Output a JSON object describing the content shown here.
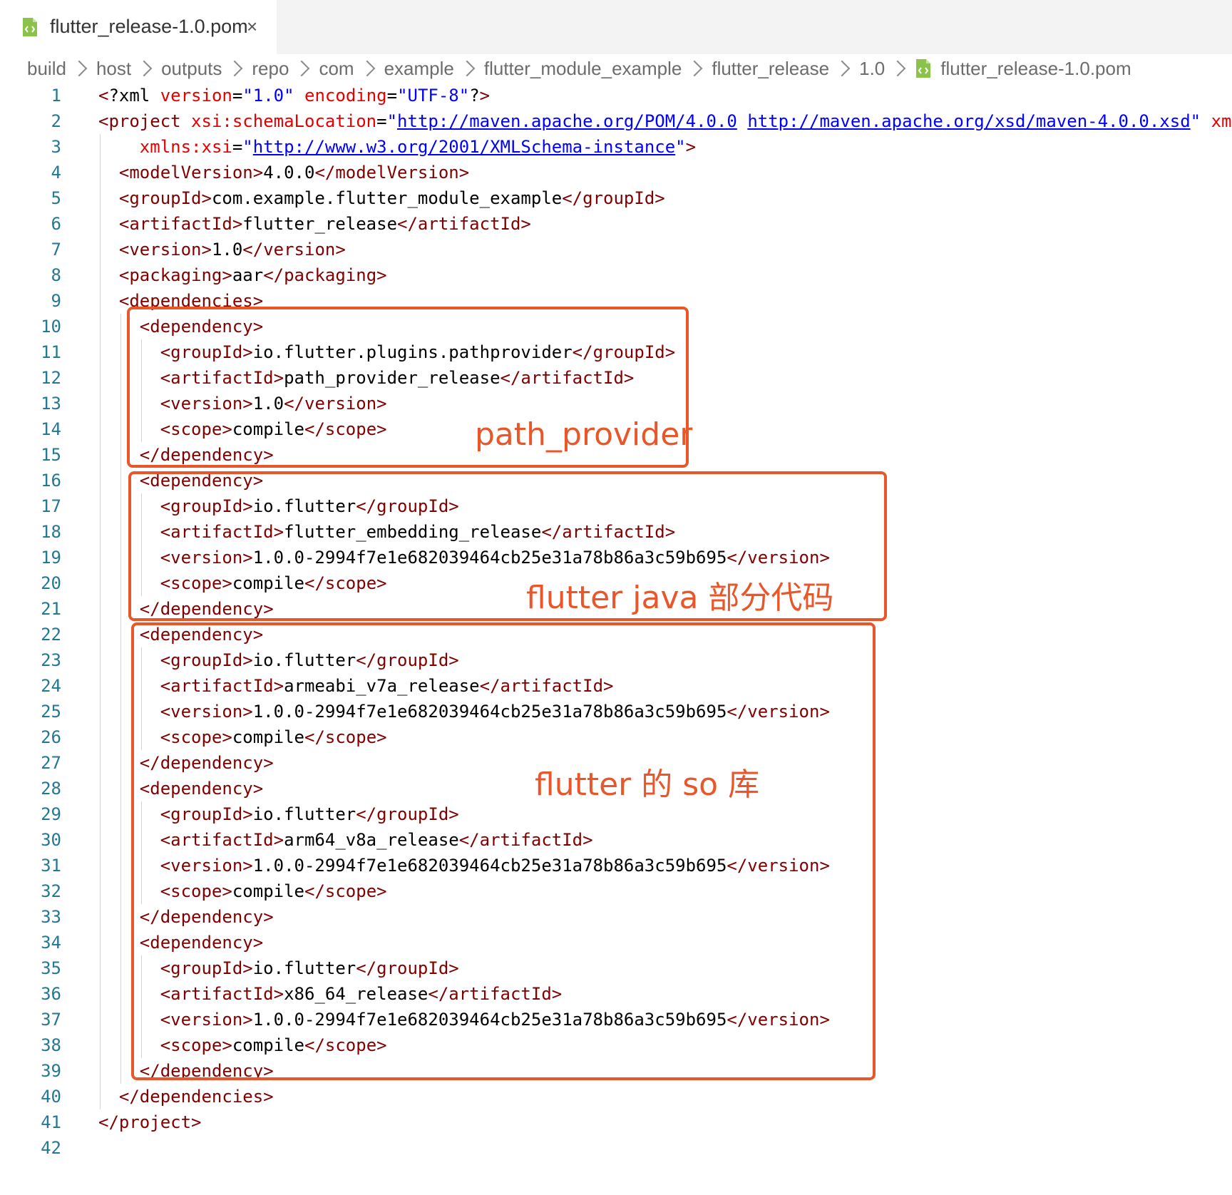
{
  "tab": {
    "title": "flutter_release-1.0.pom",
    "close_glyph": "×",
    "icon": "xml-file-icon"
  },
  "breadcrumb": [
    "build",
    "host",
    "outputs",
    "repo",
    "com",
    "example",
    "flutter_module_example",
    "flutter_release",
    "1.0",
    "flutter_release-1.0.pom"
  ],
  "colors": {
    "tag": "#800000",
    "attribute": "#e50000",
    "string": "#0000ff",
    "line_number": "#237893",
    "annotation": "#e8562a"
  },
  "code_lines": [
    [
      [
        "<",
        "t"
      ],
      [
        "?xml ",
        ""
      ],
      [
        "version",
        "a"
      ],
      [
        "=",
        ""
      ],
      [
        "\"1.0\"",
        "s"
      ],
      [
        " ",
        ""
      ],
      [
        "encoding",
        "a"
      ],
      [
        "=",
        ""
      ],
      [
        "\"UTF-8\"",
        "s"
      ],
      [
        "?",
        ""
      ],
      [
        ">",
        "t"
      ]
    ],
    [
      [
        "<project ",
        "t"
      ],
      [
        "xsi:schemaLocation",
        "a"
      ],
      [
        "=",
        ""
      ],
      [
        "\"",
        "s"
      ],
      [
        "http://maven.apache.org/POM/4.0.0",
        "u"
      ],
      [
        " ",
        ""
      ],
      [
        "http://maven.apache.org/xsd/maven-4.0.0.xsd",
        "u"
      ],
      [
        "\"",
        "s"
      ],
      [
        " ",
        ""
      ],
      [
        "xm",
        "a"
      ]
    ],
    [
      [
        "  ",
        ""
      ],
      [
        "xmlns:xsi",
        "a"
      ],
      [
        "=",
        ""
      ],
      [
        "\"",
        "s"
      ],
      [
        "http://www.w3.org/2001/XMLSchema-instance",
        "u"
      ],
      [
        "\"",
        "s"
      ],
      [
        ">",
        "t"
      ]
    ],
    [
      [
        "<modelVersion>",
        "t"
      ],
      [
        "4.0.0",
        ""
      ],
      [
        "</modelVersion>",
        "t"
      ]
    ],
    [
      [
        "<groupId>",
        "t"
      ],
      [
        "com.example.flutter_module_example",
        ""
      ],
      [
        "</groupId>",
        "t"
      ]
    ],
    [
      [
        "<artifactId>",
        "t"
      ],
      [
        "flutter_release",
        ""
      ],
      [
        "</artifactId>",
        "t"
      ]
    ],
    [
      [
        "<version>",
        "t"
      ],
      [
        "1.0",
        ""
      ],
      [
        "</version>",
        "t"
      ]
    ],
    [
      [
        "<packaging>",
        "t"
      ],
      [
        "aar",
        ""
      ],
      [
        "</packaging>",
        "t"
      ]
    ],
    [
      [
        "<dependencies>",
        "t"
      ]
    ],
    [
      [
        "<dependency>",
        "t"
      ]
    ],
    [
      [
        "<groupId>",
        "t"
      ],
      [
        "io.flutter.plugins.pathprovider",
        ""
      ],
      [
        "</groupId>",
        "t"
      ]
    ],
    [
      [
        "<artifactId>",
        "t"
      ],
      [
        "path_provider_release",
        ""
      ],
      [
        "</artifactId>",
        "t"
      ]
    ],
    [
      [
        "<version>",
        "t"
      ],
      [
        "1.0",
        ""
      ],
      [
        "</version>",
        "t"
      ]
    ],
    [
      [
        "<scope>",
        "t"
      ],
      [
        "compile",
        ""
      ],
      [
        "</scope>",
        "t"
      ]
    ],
    [
      [
        "</dependency>",
        "t"
      ]
    ],
    [
      [
        "<dependency>",
        "t"
      ]
    ],
    [
      [
        "<groupId>",
        "t"
      ],
      [
        "io.flutter",
        ""
      ],
      [
        "</groupId>",
        "t"
      ]
    ],
    [
      [
        "<artifactId>",
        "t"
      ],
      [
        "flutter_embedding_release",
        ""
      ],
      [
        "</artifactId>",
        "t"
      ]
    ],
    [
      [
        "<version>",
        "t"
      ],
      [
        "1.0.0-2994f7e1e682039464cb25e31a78b86a3c59b695",
        ""
      ],
      [
        "</version>",
        "t"
      ]
    ],
    [
      [
        "<scope>",
        "t"
      ],
      [
        "compile",
        ""
      ],
      [
        "</scope>",
        "t"
      ]
    ],
    [
      [
        "</dependency>",
        "t"
      ]
    ],
    [
      [
        "<dependency>",
        "t"
      ]
    ],
    [
      [
        "<groupId>",
        "t"
      ],
      [
        "io.flutter",
        ""
      ],
      [
        "</groupId>",
        "t"
      ]
    ],
    [
      [
        "<artifactId>",
        "t"
      ],
      [
        "armeabi_v7a_release",
        ""
      ],
      [
        "</artifactId>",
        "t"
      ]
    ],
    [
      [
        "<version>",
        "t"
      ],
      [
        "1.0.0-2994f7e1e682039464cb25e31a78b86a3c59b695",
        ""
      ],
      [
        "</version>",
        "t"
      ]
    ],
    [
      [
        "<scope>",
        "t"
      ],
      [
        "compile",
        ""
      ],
      [
        "</scope>",
        "t"
      ]
    ],
    [
      [
        "</dependency>",
        "t"
      ]
    ],
    [
      [
        "<dependency>",
        "t"
      ]
    ],
    [
      [
        "<groupId>",
        "t"
      ],
      [
        "io.flutter",
        ""
      ],
      [
        "</groupId>",
        "t"
      ]
    ],
    [
      [
        "<artifactId>",
        "t"
      ],
      [
        "arm64_v8a_release",
        ""
      ],
      [
        "</artifactId>",
        "t"
      ]
    ],
    [
      [
        "<version>",
        "t"
      ],
      [
        "1.0.0-2994f7e1e682039464cb25e31a78b86a3c59b695",
        ""
      ],
      [
        "</version>",
        "t"
      ]
    ],
    [
      [
        "<scope>",
        "t"
      ],
      [
        "compile",
        ""
      ],
      [
        "</scope>",
        "t"
      ]
    ],
    [
      [
        "</dependency>",
        "t"
      ]
    ],
    [
      [
        "<dependency>",
        "t"
      ]
    ],
    [
      [
        "<groupId>",
        "t"
      ],
      [
        "io.flutter",
        ""
      ],
      [
        "</groupId>",
        "t"
      ]
    ],
    [
      [
        "<artifactId>",
        "t"
      ],
      [
        "x86_64_release",
        ""
      ],
      [
        "</artifactId>",
        "t"
      ]
    ],
    [
      [
        "<version>",
        "t"
      ],
      [
        "1.0.0-2994f7e1e682039464cb25e31a78b86a3c59b695",
        ""
      ],
      [
        "</version>",
        "t"
      ]
    ],
    [
      [
        "<scope>",
        "t"
      ],
      [
        "compile",
        ""
      ],
      [
        "</scope>",
        "t"
      ]
    ],
    [
      [
        "</dependency>",
        "t"
      ]
    ],
    [
      [
        "</dependencies>",
        "t"
      ]
    ],
    [
      [
        "</project>",
        "t"
      ]
    ],
    []
  ],
  "indent_levels": [
    0,
    0,
    1,
    1,
    1,
    1,
    1,
    1,
    1,
    2,
    3,
    3,
    3,
    3,
    2,
    2,
    3,
    3,
    3,
    3,
    2,
    2,
    3,
    3,
    3,
    3,
    2,
    2,
    3,
    3,
    3,
    3,
    2,
    2,
    3,
    3,
    3,
    3,
    2,
    1,
    0,
    0
  ],
  "annotations": {
    "path_provider": "path_provider",
    "flutter_java": "flutter java 部分代码",
    "flutter_so": "flutter 的 so 库"
  }
}
